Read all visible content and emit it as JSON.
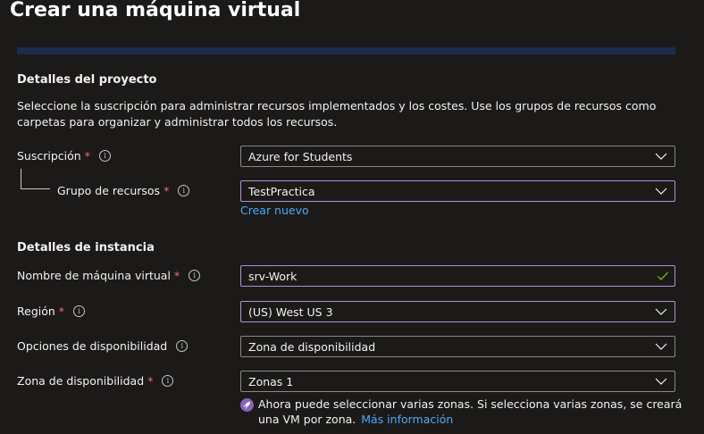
{
  "header": {
    "title": "Crear una máquina virtual",
    "more_label": "···"
  },
  "project_details": {
    "title": "Detalles del proyecto",
    "description": "Seleccione la suscripción para administrar recursos implementados y los costes. Use los grupos de recursos como carpetas para organizar y administrar todos los recursos.",
    "subscription": {
      "label": "Suscripción",
      "required_mark": "*",
      "value": "Azure for Students"
    },
    "resource_group": {
      "label": "Grupo de recursos",
      "required_mark": "*",
      "value": "TestPractica",
      "create_new_link": "Crear nuevo"
    }
  },
  "instance_details": {
    "title": "Detalles de instancia",
    "vm_name": {
      "label": "Nombre de máquina virtual",
      "required_mark": "*",
      "value": "srv-Work"
    },
    "region": {
      "label": "Región",
      "required_mark": "*",
      "value": "(US) West US 3"
    },
    "availability_options": {
      "label": "Opciones de disponibilidad",
      "value": "Zona de disponibilidad"
    },
    "availability_zone": {
      "label": "Zona de disponibilidad",
      "required_mark": "*",
      "value": "Zonas 1",
      "note": "Ahora puede seleccionar varias zonas. Si selecciona varias zonas, se creará una VM por zona.",
      "note_link": "Más información"
    }
  },
  "icons": {
    "info": "info-icon",
    "chevron": "chevron-down-icon",
    "check": "checkmark-icon",
    "rocket": "rocket-icon"
  },
  "colors": {
    "background": "#1b1a19",
    "text": "#f3f2f1",
    "required": "#f1707b",
    "focus_border": "#b38fd9",
    "link": "#4fa8f5",
    "valid_check": "#6bb700",
    "rocket_badge": "#8764b8"
  }
}
